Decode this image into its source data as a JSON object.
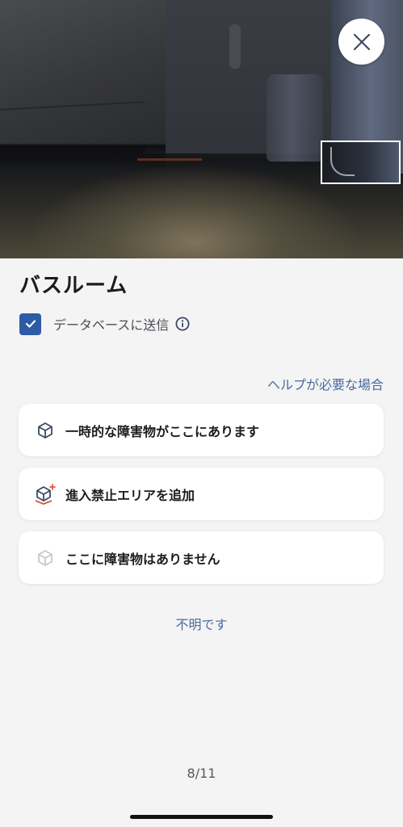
{
  "photo": {
    "close_icon": "close-icon"
  },
  "room": {
    "title": "バスルーム"
  },
  "database": {
    "checked": true,
    "label": "データベースに送信",
    "info_icon": "info-icon"
  },
  "help": {
    "label": "ヘルプが必要な場合"
  },
  "options": [
    {
      "label": "一時的な障害物がここにあります",
      "icon": "cube-icon"
    },
    {
      "label": "進入禁止エリアを追加",
      "icon": "cube-plus-icon"
    },
    {
      "label": "ここに障害物はありません",
      "icon": "cube-outline-faded-icon"
    }
  ],
  "unknown": {
    "label": "不明です"
  },
  "pagination": {
    "label": "8/11"
  },
  "colors": {
    "accent": "#2d5ba6",
    "link": "#4a6a9e",
    "background": "#f4f4f5",
    "no_go_red": "#e0583a"
  }
}
